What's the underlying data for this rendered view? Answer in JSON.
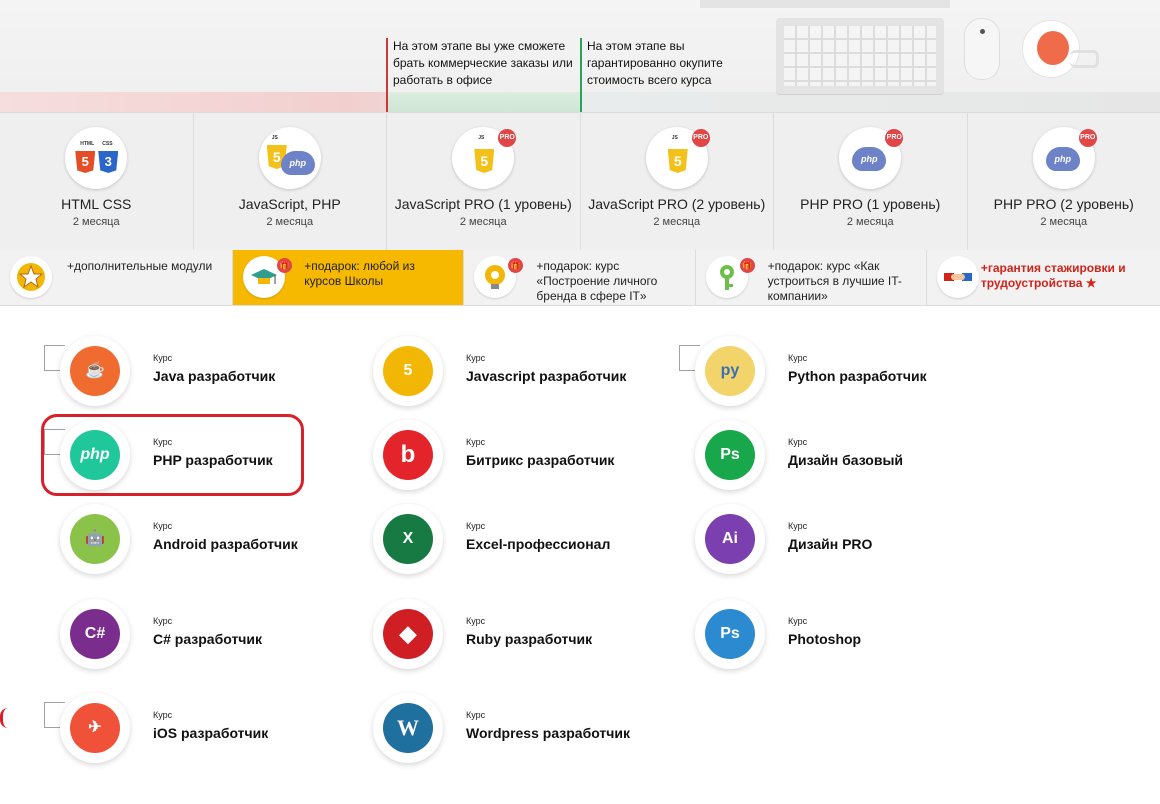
{
  "hero": {
    "note1": "На этом этапе вы уже сможете брать коммерческие заказы или работать в офисе",
    "note2": "На этом этапе вы гарантированно окупите стоимость всего курса"
  },
  "courses": [
    {
      "title": "HTML CSS",
      "duration": "2 месяца"
    },
    {
      "title": "JavaScript, PHP",
      "duration": "2 месяца"
    },
    {
      "title": "JavaScript PRO (1 уровень)",
      "duration": "2 месяца"
    },
    {
      "title": "JavaScript PRO (2 уровень)",
      "duration": "2 месяца"
    },
    {
      "title": "PHP PRO (1 уровень)",
      "duration": "2 месяца"
    },
    {
      "title": "PHP PRO (2 уровень)",
      "duration": "2 месяца"
    }
  ],
  "badges": {
    "pro": "PRO",
    "html": "HTML",
    "css": "CSS",
    "js": "JS",
    "five": "5",
    "three": "3",
    "php": "php"
  },
  "bonuses": [
    "+дополнительные модули",
    "+подарок: любой из курсов Школы",
    "+подарок: курс «Построение личного бренда в сфере IT»",
    "+подарок: курс «Как устроиться в лучшие IT-компании»",
    "+гарантия стажировки и трудоустройства ★"
  ],
  "grid": {
    "kurs_label": "Курс",
    "items": [
      {
        "name": "Java разработчик",
        "glyph": "☕",
        "color": "#f06b2f"
      },
      {
        "name": "Javascript разработчик",
        "glyph": "5",
        "color": "#f2b705"
      },
      {
        "name": "Python разработчик",
        "glyph": "py",
        "color": "#f3d46b"
      },
      {
        "name": "PHP разработчик",
        "glyph": "php",
        "color": "#1fc79a"
      },
      {
        "name": "Битрикс разработчик",
        "glyph": "b",
        "color": "#e3242b"
      },
      {
        "name": "Дизайн базовый",
        "glyph": "Ps",
        "color": "#18a84b"
      },
      {
        "name": "Android разработчик",
        "glyph": "🤖",
        "color": "#8bc34a"
      },
      {
        "name": "Excel-профессионал",
        "glyph": "X",
        "color": "#187a43"
      },
      {
        "name": "Дизайн PRO",
        "glyph": "Ai",
        "color": "#7b3fb0"
      },
      {
        "name": "C# разработчик",
        "glyph": "C#",
        "color": "#7a2d8c"
      },
      {
        "name": "Ruby разработчик",
        "glyph": "◆",
        "color": "#cf1f24"
      },
      {
        "name": "Photoshop",
        "glyph": "Ps",
        "color": "#2b8ad0"
      },
      {
        "name": "iOS разработчик",
        "glyph": "✈",
        "color": "#f05139"
      },
      {
        "name": "Wordpress разработчик",
        "glyph": "W",
        "color": "#1f6f9f"
      }
    ]
  }
}
